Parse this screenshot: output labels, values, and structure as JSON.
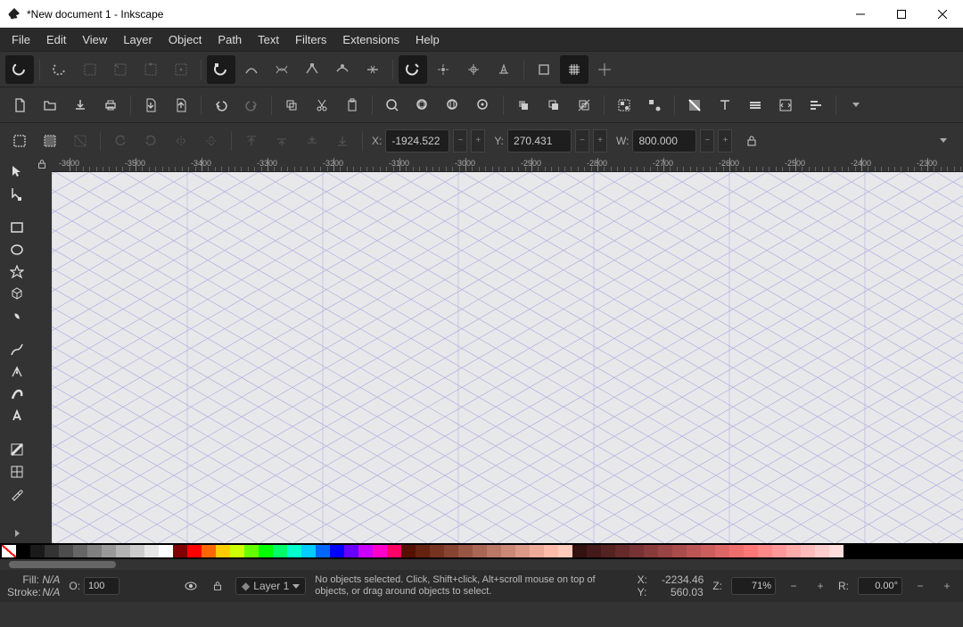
{
  "title": "*New document 1 - Inkscape",
  "menu": [
    "File",
    "Edit",
    "View",
    "Layer",
    "Object",
    "Path",
    "Text",
    "Filters",
    "Extensions",
    "Help"
  ],
  "coords": {
    "x_label": "X:",
    "x": "-1924.522",
    "y_label": "Y:",
    "y": "270.431",
    "w_label": "W:",
    "w": "800.000"
  },
  "ruler_ticks": [
    "-3600",
    "-3500",
    "-3400",
    "-3300",
    "-3200",
    "-3100",
    "-3000",
    "-2900",
    "-2800",
    "-2700",
    "-2600",
    "-2500",
    "-2400",
    "-2300"
  ],
  "palette": [
    "none",
    "#000000",
    "#1a1a1a",
    "#333333",
    "#4d4d4d",
    "#666666",
    "#808080",
    "#999999",
    "#b3b3b3",
    "#cccccc",
    "#e6e6e6",
    "#ffffff",
    "#800000",
    "#ff0000",
    "#ff6600",
    "#ffcc00",
    "#ccff00",
    "#66ff00",
    "#00ff00",
    "#00ff66",
    "#00ffcc",
    "#00ccff",
    "#0066ff",
    "#0000ff",
    "#6600ff",
    "#cc00ff",
    "#ff00cc",
    "#ff0066",
    "#551100",
    "#662211",
    "#773322",
    "#884433",
    "#995544",
    "#aa6655",
    "#bb7766",
    "#cc8877",
    "#dd9988",
    "#eeaa99",
    "#ffbbaa",
    "#ffccbb",
    "#331111",
    "#441919",
    "#552222",
    "#662a2a",
    "#773333",
    "#883b3b",
    "#994444",
    "#aa4c4c",
    "#bb5555",
    "#cc5d5d",
    "#dd6666",
    "#ee6e6e",
    "#ff7777",
    "#ff8888",
    "#ff9999",
    "#ffaaaa",
    "#ffbbbb",
    "#ffcccc",
    "#ffdddd"
  ],
  "status": {
    "fill_label": "Fill:",
    "fill_value": "N/A",
    "stroke_label": "Stroke:",
    "stroke_value": "N/A",
    "opacity_label": "O:",
    "opacity": "100",
    "layer": "Layer 1",
    "message": "No objects selected. Click, Shift+click, Alt+scroll mouse on top of objects, or drag around objects to select.",
    "cx_label": "X:",
    "cx": "-2234.46",
    "cy_label": "Y:",
    "cy": "560.03",
    "z_label": "Z:",
    "zoom": "71%",
    "r_label": "R:",
    "rotation": "0.00°"
  }
}
